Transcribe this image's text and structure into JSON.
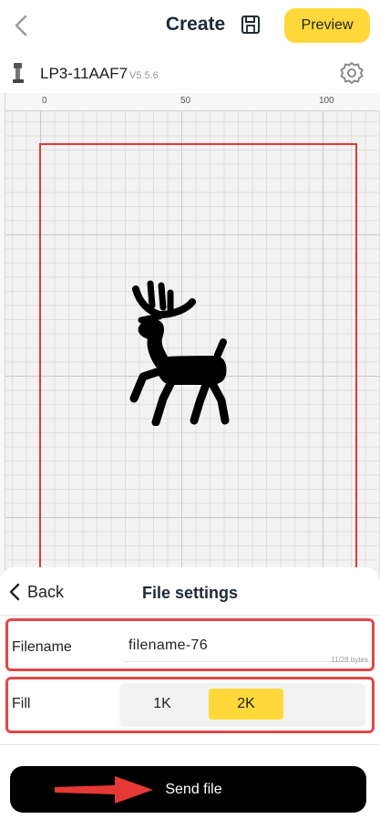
{
  "header": {
    "title": "Create",
    "preview_label": "Preview",
    "back_icon": "chevron-left-icon",
    "save_icon": "save-icon"
  },
  "device": {
    "name": "LP3-11AAF7",
    "version": "V5.5.6",
    "settings_icon": "gear-icon"
  },
  "canvas": {
    "ruler_labels": [
      "0",
      "50",
      "100"
    ],
    "work_area_color": "#e53935",
    "design_icon": "deer-icon"
  },
  "sheet": {
    "back_label": "Back",
    "title": "File settings",
    "filename_label": "Filename",
    "filename_value": "filename-76",
    "filename_count": "11/28 bytes",
    "fill_label": "Fill",
    "fill_options": [
      "1K",
      "2K"
    ],
    "fill_selected": "2K",
    "send_label": "Send file"
  },
  "colors": {
    "accent": "#ffd93b",
    "highlight": "#e04848",
    "send_bg": "#000000"
  }
}
